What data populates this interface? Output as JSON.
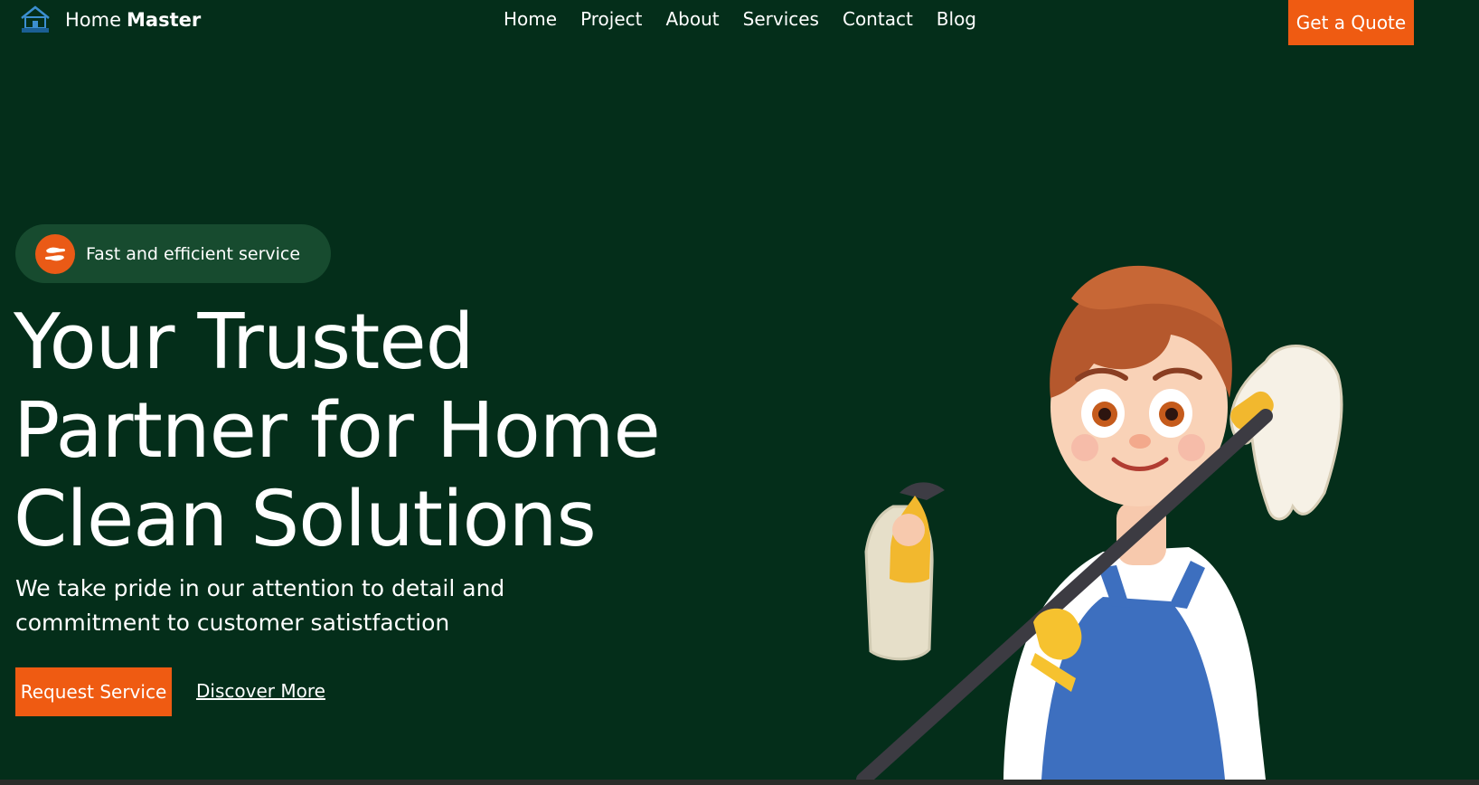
{
  "header": {
    "brand_prefix": "Home",
    "brand_strong": "Master",
    "logo_icon": "house-logo-icon",
    "nav": [
      "Home",
      "Project",
      "About",
      "Services",
      "Contact",
      "Blog"
    ],
    "quote_button": "Get a Quote"
  },
  "hero": {
    "badge": {
      "icon": "helping-hands-icon",
      "text": "Fast and efficient service"
    },
    "headline_lines": [
      "Your Trusted",
      "Partner for Home",
      "Clean Solutions"
    ],
    "description_lines": [
      "We take pride in our attention to detail and",
      "commitment to customer satistfaction"
    ],
    "primary_button": "Request Service",
    "secondary_link": "Discover More",
    "illustration": "cleaning-woman-illustration"
  },
  "colors": {
    "background": "#042e1a",
    "accent": "#ef5b12",
    "pill_background": "#174b2f",
    "text": "#ffffff"
  }
}
